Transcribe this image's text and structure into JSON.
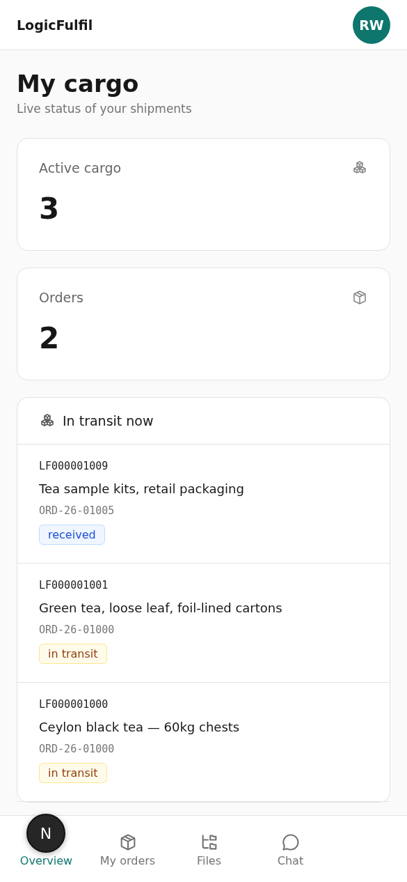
{
  "header": {
    "brand": "LogicFulfil",
    "avatar": "RW"
  },
  "page": {
    "title": "My cargo",
    "subtitle": "Live status of your shipments"
  },
  "stats": [
    {
      "label": "Active cargo",
      "value": "3",
      "kind": "boxes"
    },
    {
      "label": "Orders",
      "value": "2",
      "kind": "box"
    }
  ],
  "transit": {
    "title": "In transit now",
    "items": [
      {
        "code": "LF000001009",
        "name": "Tea sample kits, retail packaging",
        "order": "ORD-26-01005",
        "status": "received",
        "kind": "received"
      },
      {
        "code": "LF000001001",
        "name": "Green tea, loose leaf, foil-lined cartons",
        "order": "ORD-26-01000",
        "status": "in transit",
        "kind": "transit"
      },
      {
        "code": "LF000001000",
        "name": "Ceylon black tea — 60kg chests",
        "order": "ORD-26-01000",
        "status": "in transit",
        "kind": "transit"
      }
    ]
  },
  "nav": [
    {
      "label": "Overview",
      "selected": true
    },
    {
      "label": "My orders",
      "kind": "box",
      "selected": false
    },
    {
      "label": "Files",
      "kind": "files",
      "selected": false
    },
    {
      "label": "Chat",
      "kind": "chat",
      "selected": false
    }
  ],
  "dev_badge": "N"
}
